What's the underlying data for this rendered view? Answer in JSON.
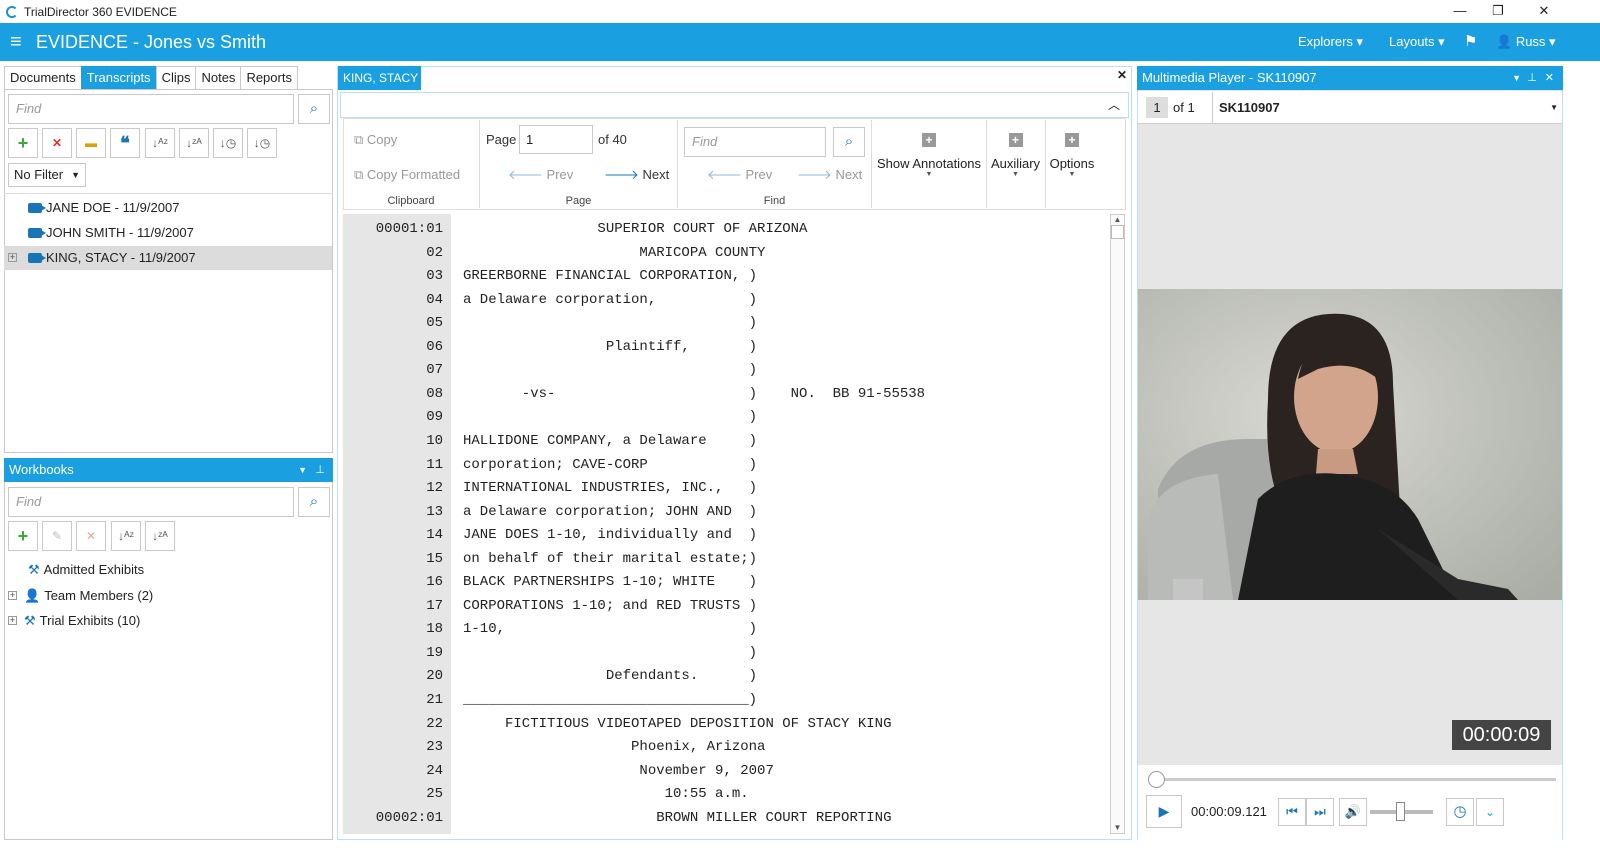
{
  "window": {
    "title": "TrialDirector 360 EVIDENCE"
  },
  "appbar": {
    "title": "EVIDENCE - Jones vs Smith",
    "explorers": "Explorers",
    "layouts": "Layouts",
    "user": "Russ"
  },
  "left": {
    "tabs": [
      "Documents",
      "Transcripts",
      "Clips",
      "Notes",
      "Reports"
    ],
    "find_placeholder": "Find",
    "filter": "No Filter",
    "items": [
      "JANE DOE - 11/9/2007",
      "JOHN SMITH - 11/9/2007",
      "KING, STACY - 11/9/2007"
    ]
  },
  "workbooks": {
    "title": "Workbooks",
    "find_placeholder": "Find",
    "items": [
      "Admitted Exhibits",
      "Team Members (2)",
      "Trial Exhibits (10)"
    ]
  },
  "transcript": {
    "tab": "KING, STACY",
    "copy": "Copy",
    "copy_formatted": "Copy Formatted",
    "clipboard": "Clipboard",
    "page_label": "Page",
    "page_value": "1",
    "of_pages": "of 40",
    "prev": "Prev",
    "next": "Next",
    "page_group": "Page",
    "find_placeholder": "Find",
    "find_prev": "Prev",
    "find_next": "Next",
    "find_group": "Find",
    "show_annotations": "Show Annotations",
    "auxiliary": "Auxiliary",
    "options": "Options",
    "lines": [
      {
        "n": "00001:01",
        "t": "                SUPERIOR COURT OF ARIZONA"
      },
      {
        "n": "02",
        "t": "                     MARICOPA COUNTY"
      },
      {
        "n": "03",
        "t": "GREERBORNE FINANCIAL CORPORATION, )"
      },
      {
        "n": "04",
        "t": "a Delaware corporation,           )"
      },
      {
        "n": "05",
        "t": "                                  )"
      },
      {
        "n": "06",
        "t": "                 Plaintiff,       )"
      },
      {
        "n": "07",
        "t": "                                  )"
      },
      {
        "n": "08",
        "t": "       -vs-                       )    NO.  BB 91-55538"
      },
      {
        "n": "09",
        "t": "                                  )"
      },
      {
        "n": "10",
        "t": "HALLIDONE COMPANY, a Delaware     )"
      },
      {
        "n": "11",
        "t": "corporation; CAVE-CORP            )"
      },
      {
        "n": "12",
        "t": "INTERNATIONAL INDUSTRIES, INC.,   )"
      },
      {
        "n": "13",
        "t": "a Delaware corporation; JOHN AND  )"
      },
      {
        "n": "14",
        "t": "JANE DOES 1-10, individually and  )"
      },
      {
        "n": "15",
        "t": "on behalf of their marital estate;)"
      },
      {
        "n": "16",
        "t": "BLACK PARTNERSHIPS 1-10; WHITE    )"
      },
      {
        "n": "17",
        "t": "CORPORATIONS 1-10; and RED TRUSTS )"
      },
      {
        "n": "18",
        "t": "1-10,                             )"
      },
      {
        "n": "19",
        "t": "                                  )"
      },
      {
        "n": "20",
        "t": "                 Defendants.      )"
      },
      {
        "n": "21",
        "t": "__________________________________)"
      },
      {
        "n": "22",
        "t": "     FICTITIOUS VIDEOTAPED DEPOSITION OF STACY KING"
      },
      {
        "n": "23",
        "t": "                    Phoenix, Arizona"
      },
      {
        "n": "24",
        "t": "                     November 9, 2007"
      },
      {
        "n": "25",
        "t": "                        10:55 a.m."
      },
      {
        "n": "00002:01",
        "t": "                       BROWN MILLER COURT REPORTING"
      }
    ]
  },
  "player": {
    "title": "Multimedia Player - SK110907",
    "index": "1",
    "of": "of 1",
    "clip": "SK110907",
    "timecode": "00:00:09",
    "position": "00:00:09.121"
  }
}
